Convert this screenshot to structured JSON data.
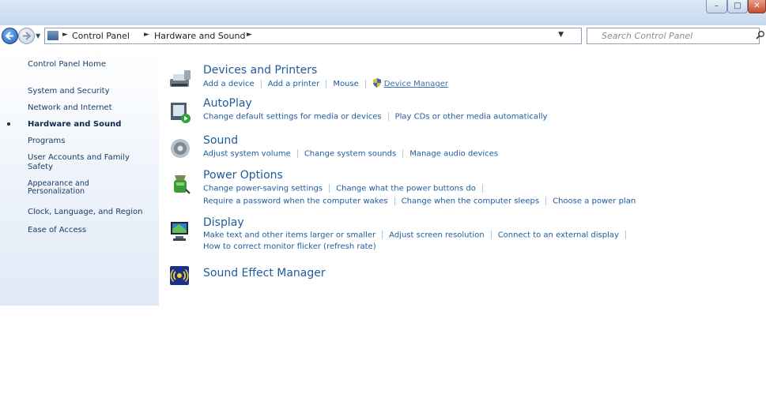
{
  "address_bar": {
    "breadcrumb": [
      "Control Panel",
      "Hardware and Sound"
    ],
    "search_placeholder": "Search Control Panel"
  },
  "sidebar": {
    "home": "Control Panel Home",
    "items": [
      {
        "label": "System and Security"
      },
      {
        "label": "Network and Internet"
      },
      {
        "label": "Hardware and Sound",
        "active": true
      },
      {
        "label": "Programs"
      },
      {
        "label": "User Accounts and Family\nSafety"
      },
      {
        "label": "Appearance and\nPersonalization"
      },
      {
        "label": "Clock, Language, and Region"
      },
      {
        "label": "Ease of Access"
      }
    ]
  },
  "categories": [
    {
      "title": "Devices and Printers",
      "icon": "devices-printers-icon",
      "links": [
        [
          "Add a device",
          "Add a printer",
          "Mouse",
          "Device Manager"
        ]
      ]
    },
    {
      "title": "AutoPlay",
      "icon": "autoplay-icon",
      "links": [
        [
          "Change default settings for media or devices",
          "Play CDs or other media automatically"
        ]
      ]
    },
    {
      "title": "Sound",
      "icon": "sound-icon",
      "links": [
        [
          "Adjust system volume",
          "Change system sounds",
          "Manage audio devices"
        ]
      ]
    },
    {
      "title": "Power Options",
      "icon": "power-options-icon",
      "links": [
        [
          "Change power-saving settings",
          "Change what the power buttons do"
        ],
        [
          "Require a password when the computer wakes",
          "Change when the computer sleeps",
          "Choose a power plan"
        ]
      ]
    },
    {
      "title": "Display",
      "icon": "display-icon",
      "links": [
        [
          "Make text and other items larger or smaller",
          "Adjust screen resolution",
          "Connect to an external display"
        ],
        [
          "How to correct monitor flicker (refresh rate)"
        ]
      ]
    },
    {
      "title": "Sound Effect Manager",
      "icon": "sound-effect-manager-icon",
      "links": []
    }
  ],
  "colors": {
    "link": "#1e5b9c",
    "sidebar_text": "#1b3c68"
  }
}
